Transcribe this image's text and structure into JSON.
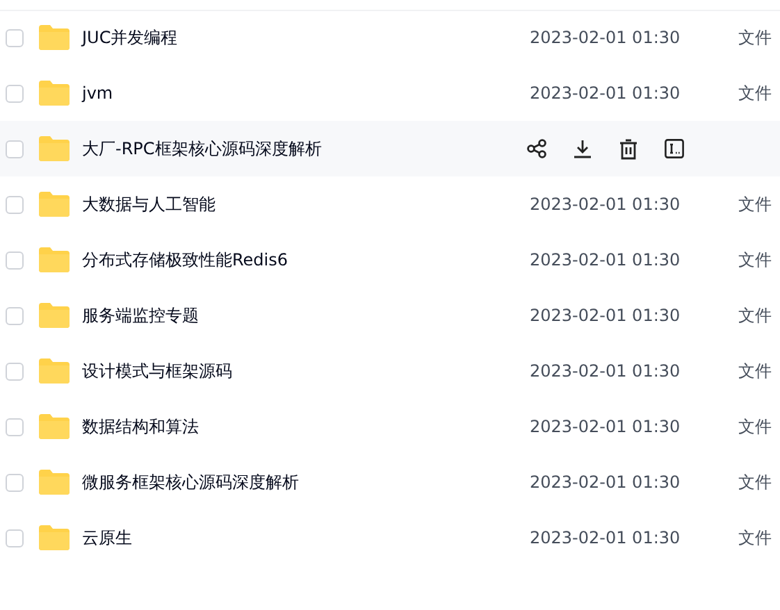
{
  "rows": [
    {
      "name": "JUC并发编程",
      "date": "2023-02-01 01:30",
      "type": "文件",
      "checked": false,
      "hovered": false
    },
    {
      "name": "jvm",
      "date": "2023-02-01 01:30",
      "type": "文件",
      "checked": false,
      "hovered": false
    },
    {
      "name": "大厂-RPC框架核心源码深度解析",
      "checked": false,
      "hovered": true,
      "actions": [
        {
          "kind": "share"
        },
        {
          "kind": "download"
        },
        {
          "kind": "delete"
        },
        {
          "kind": "rename"
        }
      ]
    },
    {
      "name": "大数据与人工智能",
      "date": "2023-02-01 01:30",
      "type": "文件",
      "checked": false,
      "hovered": false
    },
    {
      "name": "分布式存储极致性能Redis6",
      "date": "2023-02-01 01:30",
      "type": "文件",
      "checked": false,
      "hovered": false
    },
    {
      "name": "服务端监控专题",
      "date": "2023-02-01 01:30",
      "type": "文件",
      "checked": false,
      "hovered": false
    },
    {
      "name": "设计模式与框架源码",
      "date": "2023-02-01 01:30",
      "type": "文件",
      "checked": false,
      "hovered": false
    },
    {
      "name": "数据结构和算法",
      "date": "2023-02-01 01:30",
      "type": "文件",
      "checked": false,
      "hovered": false
    },
    {
      "name": "微服务框架核心源码深度解析",
      "date": "2023-02-01 01:30",
      "type": "文件",
      "checked": false,
      "hovered": false
    },
    {
      "name": "云原生",
      "date": "2023-02-01 01:30",
      "type": "文件",
      "checked": false,
      "hovered": false
    }
  ]
}
